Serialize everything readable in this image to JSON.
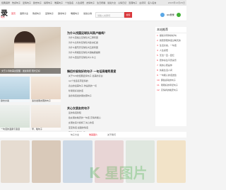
{
  "topnav": {
    "items": [
      "经典语录",
      "伤感句子",
      "爱情句子",
      "励志句子",
      "搞笑句子",
      "唯美句子",
      "个性签名",
      "人生感悟",
      "友情句子",
      "生日祝福",
      "说说大全",
      "心情日记",
      "哲理句子",
      "古诗词",
      "名人名言"
    ],
    "date": "2023年12月25日"
  },
  "header": {
    "logo": "录",
    "logo_sub": "句子",
    "nav": [
      "首页",
      "语录大全",
      "伤感句子",
      "爱情句子",
      "励志句子",
      "唯美句子",
      "说说心情",
      "经典台词",
      "古诗词"
    ],
    "nav_active_index": 0,
    "search_placeholder": "请输入关键词",
    "search_button": "搜索",
    "qq_label": "QQ登录",
    "wx_label": "微信登录"
  },
  "hero": {
    "caption": "文艺小清新美女配图 · 发丝萦绕 阳光正好"
  },
  "thumbs": [
    {
      "caption": "励志文案"
    },
    {
      "caption": "适合发朋友圈的句子"
    },
    {
      "caption": "一句话的温柔与浪漫"
    },
    {
      "caption": "早、晚句子"
    }
  ],
  "sections": [
    {
      "title": "为什么找国足球队叫高卢雄鸡？",
      "items": [
        "为什么英格兰足球队叫三狮军团",
        "为什么比利时足球队叫欧洲红魔",
        "为什么葡萄牙足球队叫五盾军团",
        "为什么阿根廷足球队叫潘帕斯雄鹰",
        "为什么西班牙足球队叫斗牛士"
      ]
    },
    {
      "title": "情侣吵架和好的句子 一句话高端秀恩爱",
      "items": [
        "关于520的经典爱情句子 最美的表白",
        "qq个性签名带爱情的",
        "表白的最美句子,你是我的一切",
        "吵架和好说的话",
        "适合情侣发的朋友圈句子"
      ]
    },
    {
      "title": "关心女朋友的句子",
      "items": [
        "爱的情话简短",
        "给女朋友晚安的一句话 高情商暖心",
        "女朋友来大姨妈了关心的话",
        "宝宝情话,最甜的情话",
        "恋爱中的甜蜜句子"
      ]
    }
  ],
  "right": {
    "title": "本站推荐",
    "items": [
      "继续对待你的好句",
      "我愿意陪你度过每天的",
      "生活文案，一句话",
      "人生感悟",
      "无法一直…回忆",
      "愿你余生平安喜乐",
      "我的心愿是你",
      "执着生活人间",
      "一句暖心的话送给",
      "那些感动的句子",
      "刚刚好的年纪句子",
      "高情商的晚安句子"
    ]
  },
  "bottom": {
    "tabs": [
      "句子大全",
      "唯美图片",
      "关于我们"
    ],
    "active_index": 1
  },
  "gallery_colors": [
    "#e6dcd1",
    "#d9c9b9",
    "#cdd9e6",
    "#e8d5d5",
    "#dfe7df",
    "#f2e3c8"
  ],
  "watermark": "K 星图片"
}
